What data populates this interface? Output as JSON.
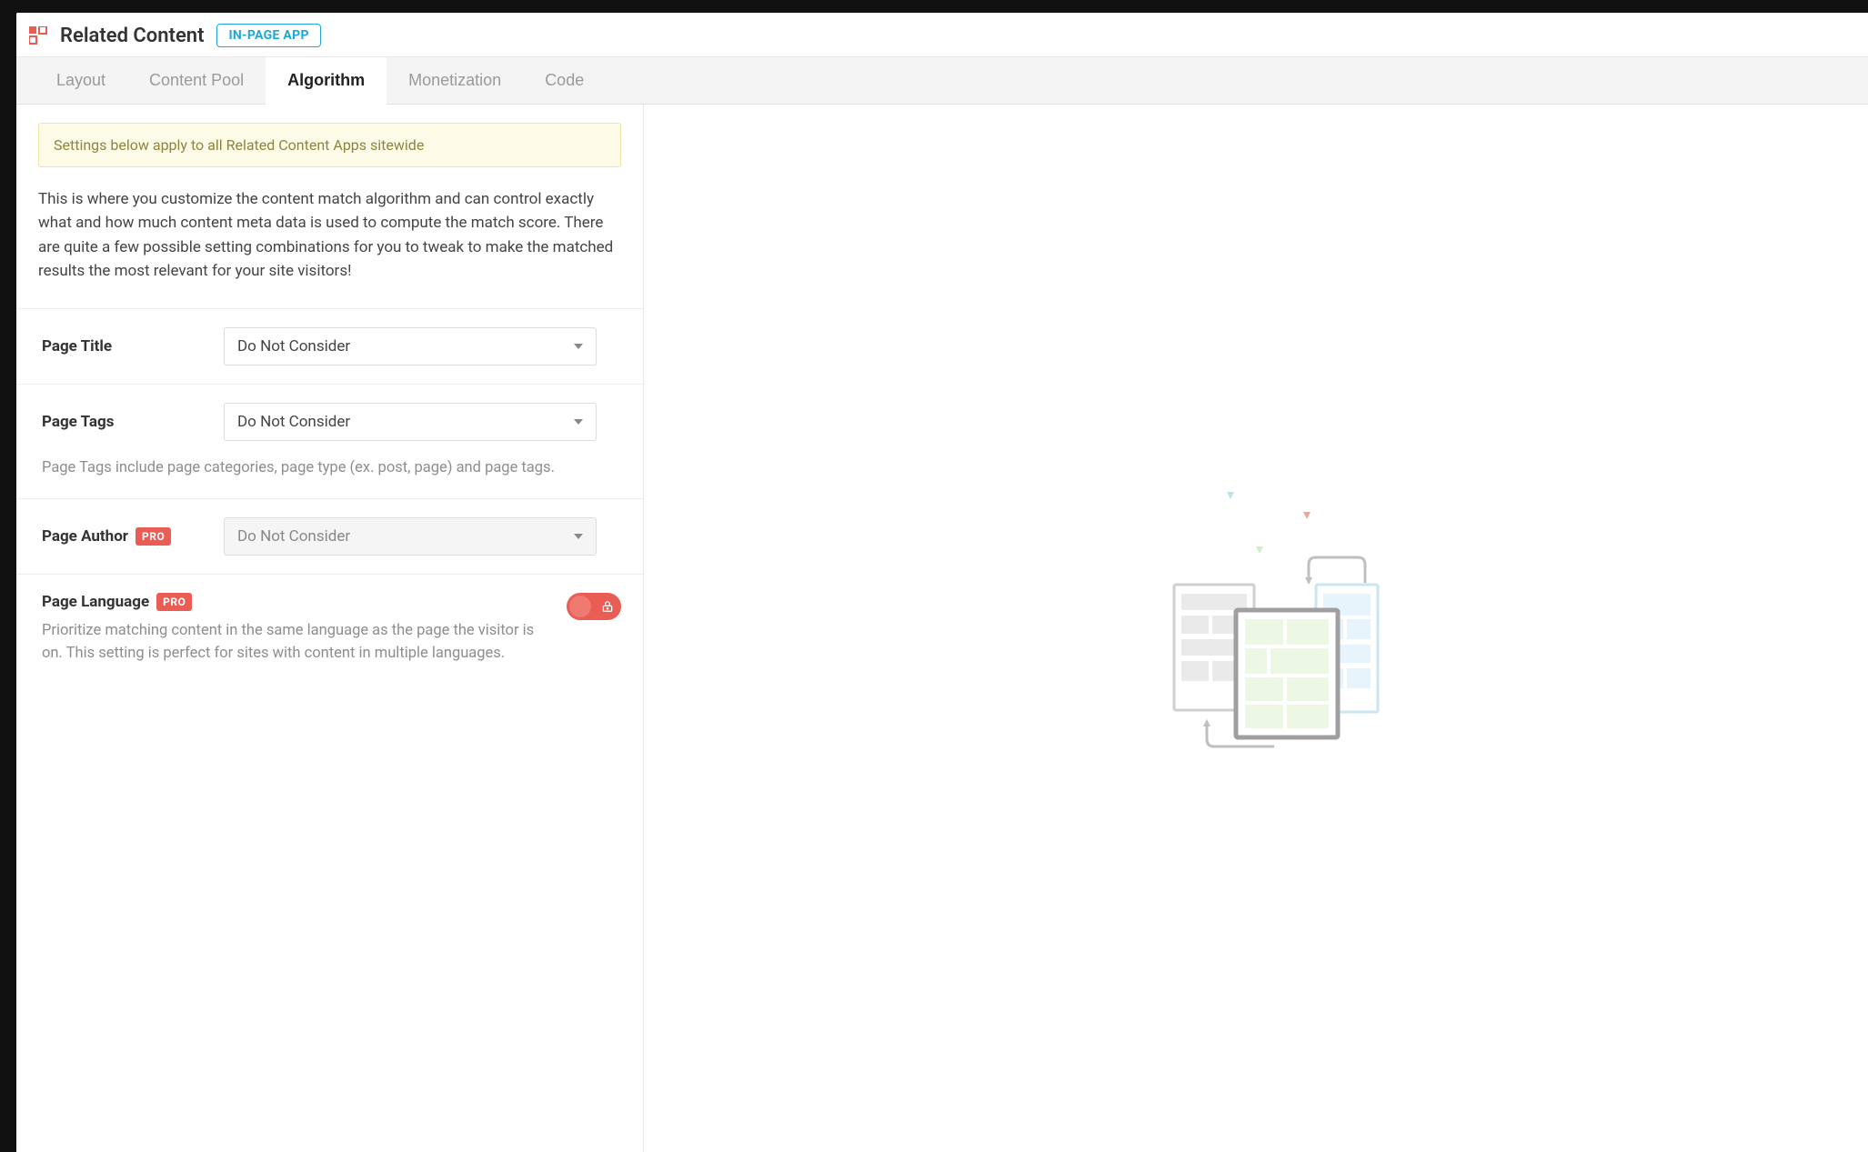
{
  "header": {
    "title": "Related Content",
    "badge": "IN-PAGE APP"
  },
  "tabs": [
    {
      "id": "layout",
      "label": "Layout",
      "active": false
    },
    {
      "id": "content-pool",
      "label": "Content Pool",
      "active": false
    },
    {
      "id": "algorithm",
      "label": "Algorithm",
      "active": true
    },
    {
      "id": "monetization",
      "label": "Monetization",
      "active": false
    },
    {
      "id": "code",
      "label": "Code",
      "active": false
    }
  ],
  "notice": "Settings below apply to all Related Content Apps sitewide",
  "intro": "This is where you customize the content match algorithm and can control exactly what and how much content meta data is used to compute the match score. There are quite a few possible setting combinations for you to tweak to make the matched results the most relevant for your site visitors!",
  "fields": {
    "page_title": {
      "label": "Page Title",
      "value": "Do Not Consider"
    },
    "page_tags": {
      "label": "Page Tags",
      "value": "Do Not Consider",
      "help": "Page Tags include page categories, page type (ex. post, page) and page tags."
    },
    "page_author": {
      "label": "Page Author",
      "pro": "PRO",
      "value": "Do Not Consider"
    },
    "page_language": {
      "label": "Page Language",
      "pro": "PRO",
      "help": "Prioritize matching content in the same language as the page the visitor is on. This setting is perfect for sites with content in multiple languages."
    }
  },
  "colors": {
    "accent_blue": "#1ea7d4",
    "accent_red": "#e95d54"
  }
}
